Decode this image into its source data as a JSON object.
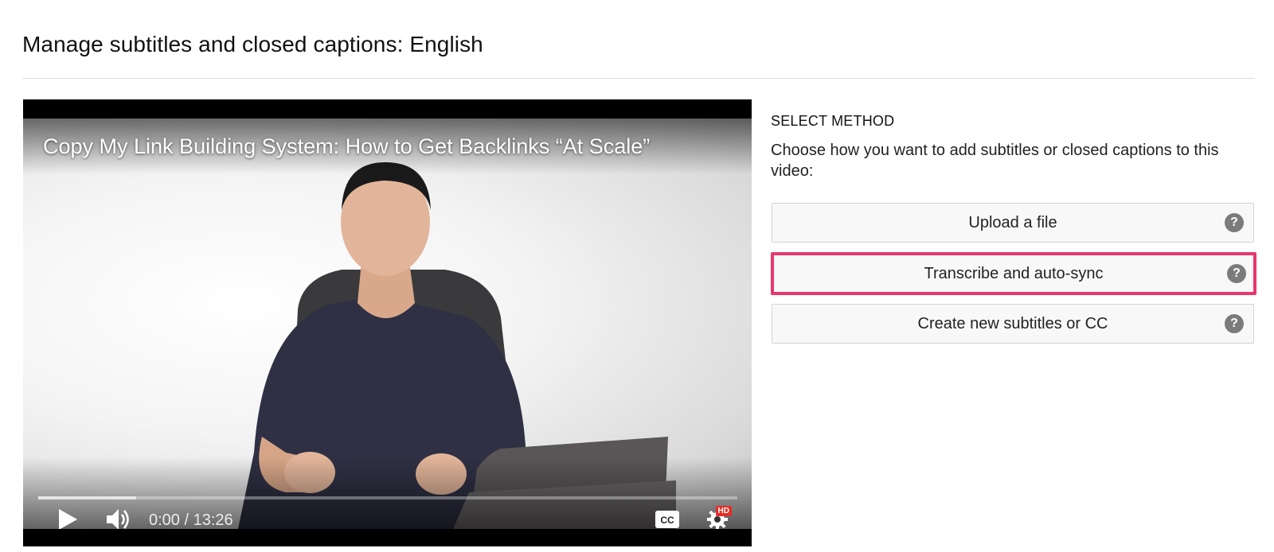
{
  "page": {
    "title": "Manage subtitles and closed captions: English"
  },
  "player": {
    "video_title": "Copy My Link Building System: How to Get Backlinks “At Scale”",
    "time": "0:00 / 13:26",
    "progress_fraction": 0.0,
    "buffered_fraction": 0.14,
    "hd_badge": "HD",
    "icons": {
      "play": "play-icon",
      "volume": "volume-icon",
      "captions": "cc-icon",
      "settings": "gear-icon"
    }
  },
  "method": {
    "heading": "SELECT METHOD",
    "description": "Choose how you want to add subtitles or closed captions to this video:",
    "options": [
      {
        "label": "Upload a file",
        "help": "?"
      },
      {
        "label": "Transcribe and auto-sync",
        "help": "?"
      },
      {
        "label": "Create new subtitles or CC",
        "help": "?"
      }
    ],
    "highlight_color": "#e9366f"
  }
}
